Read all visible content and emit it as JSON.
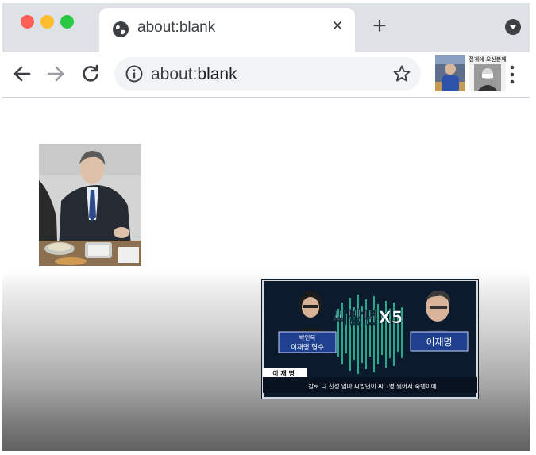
{
  "browser": {
    "tab": {
      "title": "about:blank"
    },
    "toolbar": {
      "url_prefix": "about:",
      "url_host": "blank"
    },
    "extension_2_caption": "절계에 오신분께"
  },
  "thumbnail": {
    "headline": "씨발년X5",
    "left_name": "박인복",
    "left_role": "이재명 형수",
    "right_name": "이재명",
    "speaker_tag": "이 재 명",
    "subtitle": "칼로 니 친정 엄마 씨발년이 씨그명 찢어서 죽탱이에"
  },
  "colors": {
    "tabstrip": "#dee1e6",
    "omnibox": "#f1f3f4",
    "thumb_bg": "#0c1a2e",
    "caption_blue": "#1f3f8f"
  }
}
